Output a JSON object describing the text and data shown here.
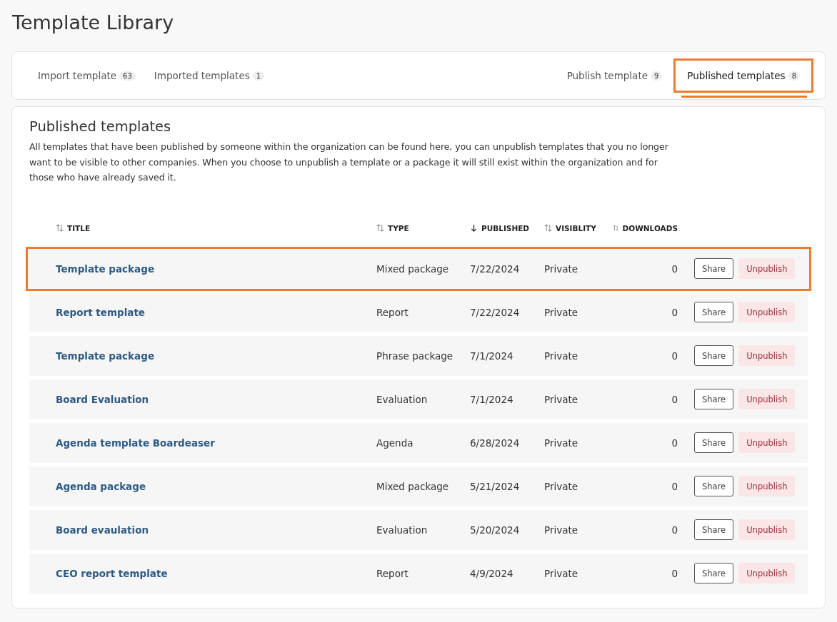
{
  "page_title": "Template Library",
  "tabs_left": [
    {
      "label": "Import template",
      "count": "63",
      "selected": false
    },
    {
      "label": "Imported templates",
      "count": "1",
      "selected": false
    }
  ],
  "tabs_right": [
    {
      "label": "Publish template",
      "count": "9",
      "selected": false
    },
    {
      "label": "Published templates",
      "count": "8",
      "selected": true
    }
  ],
  "section": {
    "title": "Published templates",
    "description": "All templates that have been published by someone within the organization can be found here, you can unpublish templates that you no longer want to be visible to other companies. When you choose to unpublish a template or a package it will still exist within the organization and for those who have already saved it."
  },
  "table": {
    "columns": [
      {
        "label": "TITLE",
        "sorted": false
      },
      {
        "label": "TYPE",
        "sorted": false
      },
      {
        "label": "PUBLISHED",
        "sorted": true
      },
      {
        "label": "VISIBLITY",
        "sorted": false
      },
      {
        "label": "DOWNLOADS",
        "sorted": false
      }
    ],
    "rows": [
      {
        "title": "Template package",
        "type": "Mixed package",
        "published": "7/22/2024",
        "visibility": "Private",
        "downloads": "0",
        "highlighted": true,
        "share": "Share",
        "unpublish": "Unpublish"
      },
      {
        "title": "Report template",
        "type": "Report",
        "published": "7/22/2024",
        "visibility": "Private",
        "downloads": "0",
        "highlighted": false,
        "share": "Share",
        "unpublish": "Unpublish"
      },
      {
        "title": "Template package",
        "type": "Phrase package",
        "published": "7/1/2024",
        "visibility": "Private",
        "downloads": "0",
        "highlighted": false,
        "share": "Share",
        "unpublish": "Unpublish"
      },
      {
        "title": "Board Evaluation",
        "type": "Evaluation",
        "published": "7/1/2024",
        "visibility": "Private",
        "downloads": "0",
        "highlighted": false,
        "share": "Share",
        "unpublish": "Unpublish"
      },
      {
        "title": "Agenda template Boardeaser",
        "type": "Agenda",
        "published": "6/28/2024",
        "visibility": "Private",
        "downloads": "0",
        "highlighted": false,
        "share": "Share",
        "unpublish": "Unpublish"
      },
      {
        "title": "Agenda package",
        "type": "Mixed package",
        "published": "5/21/2024",
        "visibility": "Private",
        "downloads": "0",
        "highlighted": false,
        "share": "Share",
        "unpublish": "Unpublish"
      },
      {
        "title": "Board evaulation",
        "type": "Evaluation",
        "published": "5/20/2024",
        "visibility": "Private",
        "downloads": "0",
        "highlighted": false,
        "share": "Share",
        "unpublish": "Unpublish"
      },
      {
        "title": "CEO report template",
        "type": "Report",
        "published": "4/9/2024",
        "visibility": "Private",
        "downloads": "0",
        "highlighted": false,
        "share": "Share",
        "unpublish": "Unpublish"
      }
    ]
  }
}
